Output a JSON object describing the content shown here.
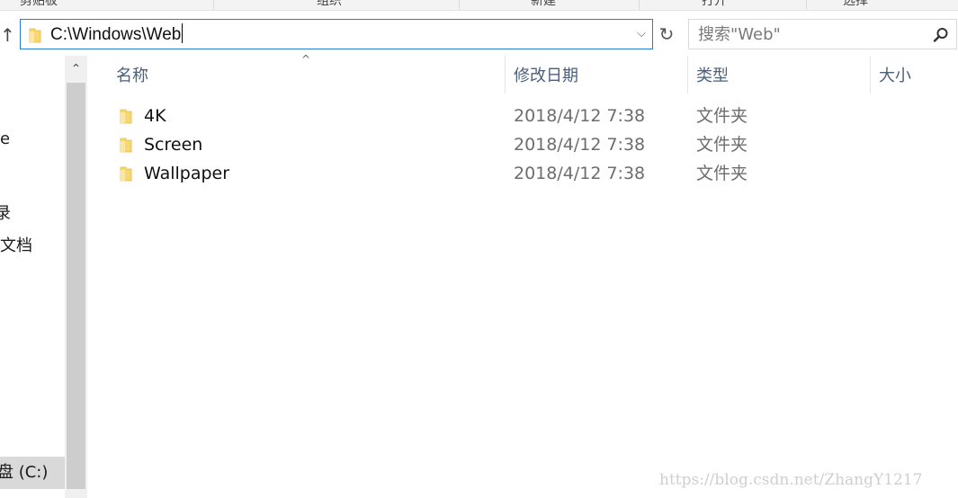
{
  "ribbon": {
    "groups": [
      "剪贴板",
      "组织",
      "新建",
      "打开",
      "选择"
    ]
  },
  "address": {
    "path": "C:\\Windows\\Web",
    "dropdown_glyph": "⌵",
    "up_glyph": "↑",
    "refresh_glyph": "↻"
  },
  "search": {
    "placeholder": "搜索\"Web\""
  },
  "nav": {
    "items": [
      "e",
      "录",
      "文档",
      "盘 (C:)"
    ],
    "scroll_up_glyph": "⌃"
  },
  "columns": {
    "sort_glyph": "^",
    "name": "名称",
    "date": "修改日期",
    "type": "类型",
    "size": "大小"
  },
  "files": [
    {
      "name": "4K",
      "date": "2018/4/12 7:38",
      "type": "文件夹"
    },
    {
      "name": "Screen",
      "date": "2018/4/12 7:38",
      "type": "文件夹"
    },
    {
      "name": "Wallpaper",
      "date": "2018/4/12 7:38",
      "type": "文件夹"
    }
  ],
  "watermark": "https://blog.csdn.net/ZhangY1217",
  "colors": {
    "accent_border": "#2b79d6",
    "header_text": "#4c607a",
    "folder_yellow": "#f7d774"
  }
}
